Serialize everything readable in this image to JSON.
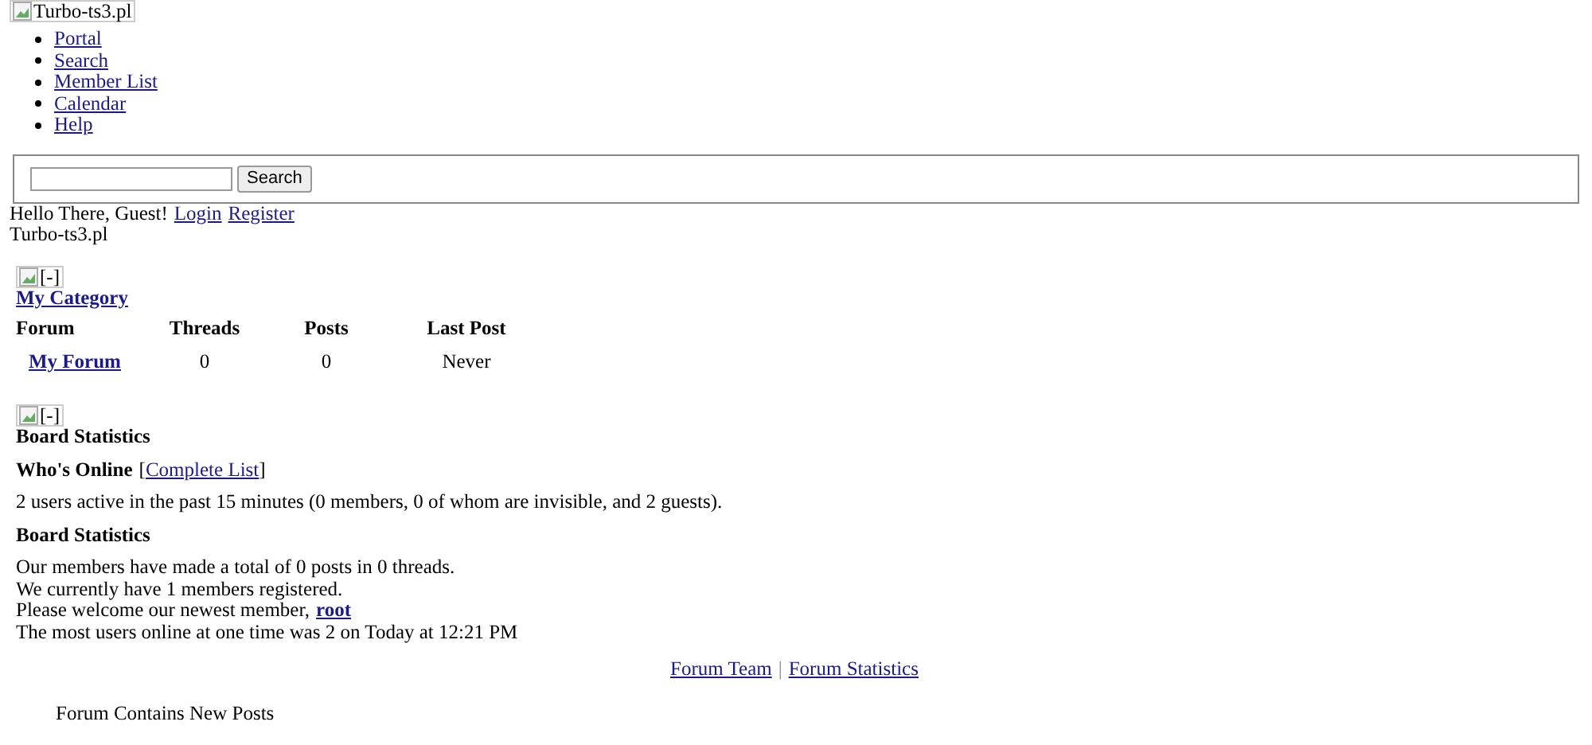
{
  "logo": {
    "alt": "Turbo-ts3.pl"
  },
  "nav": [
    "Portal",
    "Search",
    "Member List",
    "Calendar",
    "Help"
  ],
  "search": {
    "button": "Search"
  },
  "welcome": {
    "text": "Hello There, Guest!",
    "links": [
      "Login",
      "Register"
    ]
  },
  "site_name": "Turbo-ts3.pl",
  "category": {
    "toggle": "[-]",
    "title": "My Category",
    "columns": [
      "Forum",
      "Threads",
      "Posts",
      "Last Post"
    ],
    "rows": [
      {
        "forum": "My Forum",
        "threads": "0",
        "posts": "0",
        "last_post": "Never"
      }
    ]
  },
  "stats": {
    "toggle": "[-]",
    "title": "Board Statistics",
    "online_heading": "Who's Online",
    "bracket_open": "[",
    "online_link": "Complete List",
    "bracket_close": "]",
    "online_text": "2 users active in the past 15 minutes (0 members, 0 of whom are invisible, and 2 guests).",
    "stats_heading": "Board Statistics",
    "lines": [
      "Our members have made a total of 0 posts in 0 threads.",
      "We currently have 1 members registered."
    ],
    "newest_text": "Please welcome our newest member,",
    "newest_member": "root",
    "record": "The most users online at one time was 2 on Today at 12:21 PM"
  },
  "footer_links": [
    "Forum Team",
    "Forum Statistics"
  ],
  "footer_separator": "|",
  "legend": "Forum Contains New Posts"
}
